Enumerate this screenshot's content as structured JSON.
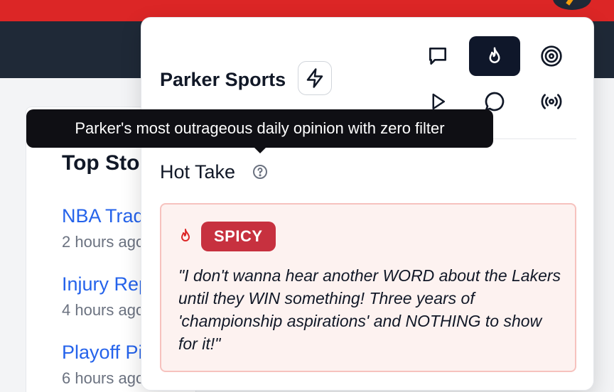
{
  "stories": {
    "title": "Top Stories",
    "items": [
      {
        "title": "NBA Trade Rumors",
        "time": "2 hours ago"
      },
      {
        "title": "Injury Report",
        "time": "4 hours ago"
      },
      {
        "title": "Playoff Picture",
        "time": "6 hours ago"
      }
    ]
  },
  "popover": {
    "brand": "Parker Sports",
    "icons": {
      "bolt": "bolt-icon",
      "row1": [
        "message-square-icon",
        "flame-icon",
        "target-icon"
      ],
      "row2": [
        "play-icon",
        "message-circle-icon",
        "broadcast-icon"
      ],
      "active": "flame-icon"
    },
    "section_title": "Hot Take",
    "badge": "SPICY",
    "quote": "\"I don't wanna hear another WORD about the Lakers until they WIN something! Three years of 'championship aspirations' and NOTHING to show for it!\""
  },
  "tooltip": {
    "text": "Parker's most outrageous daily opinion with zero filter"
  },
  "colors": {
    "header_red": "#dc2626",
    "nav_dark": "#1f2937",
    "active_button": "#0f172a",
    "link_blue": "#2563eb",
    "badge_red": "#c7313f",
    "card_bg": "#fdf2f0",
    "card_border": "#f6c2be",
    "flame_red": "#dc2626"
  }
}
